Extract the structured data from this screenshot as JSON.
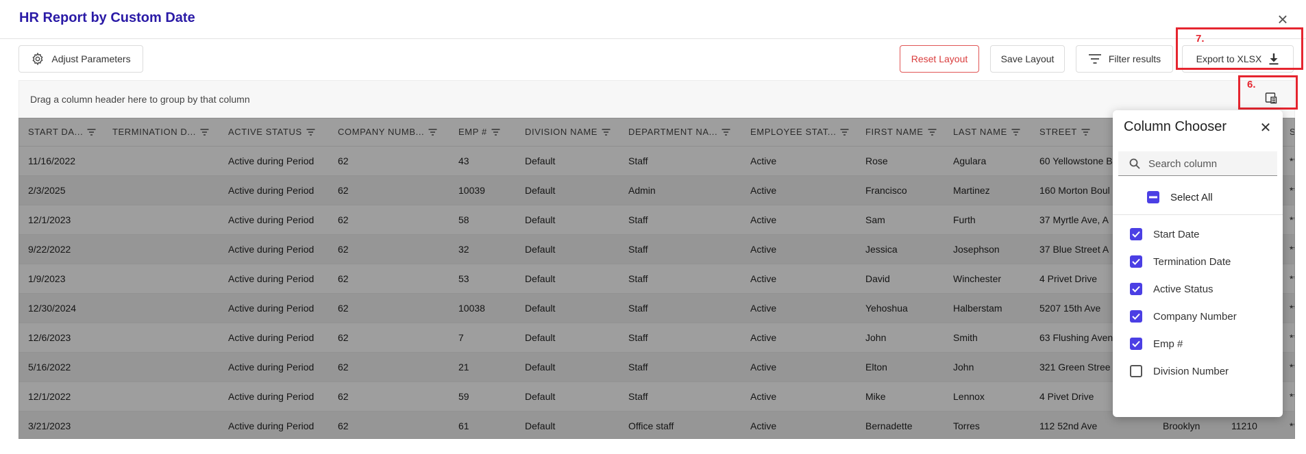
{
  "dialog": {
    "title": "HR Report by Custom Date"
  },
  "toolbar": {
    "adjust_label": "Adjust Parameters",
    "reset_label": "Reset Layout",
    "save_label": "Save Layout",
    "filter_label": "Filter results",
    "export_label": "Export to XLSX"
  },
  "annotations": {
    "seven": "7.",
    "six": "6."
  },
  "grid": {
    "group_hint": "Drag a column header here to group by that column",
    "columns": [
      "START DA...",
      "TERMINATION D...",
      "ACTIVE STATUS",
      "COMPANY NUMB...",
      "EMP #",
      "DIVISION NAME",
      "DEPARTMENT NA...",
      "EMPLOYEE STAT...",
      "FIRST NAME",
      "LAST NAME",
      "STREET",
      "",
      "",
      "S"
    ],
    "rows": [
      [
        "11/16/2022",
        "",
        "Active during Period",
        "62",
        "43",
        "Default",
        "Staff",
        "Active",
        "Rose",
        "Agulara",
        "60 Yellowstone B",
        "",
        "",
        "**"
      ],
      [
        "2/3/2025",
        "",
        "Active during Period",
        "62",
        "10039",
        "Default",
        "Admin",
        "Active",
        "Francisco",
        "Martinez",
        "160 Morton Boul",
        "",
        "",
        "**"
      ],
      [
        "12/1/2023",
        "",
        "Active during Period",
        "62",
        "58",
        "Default",
        "Staff",
        "Active",
        "Sam",
        "Furth",
        "37 Myrtle Ave, A",
        "",
        "",
        "**"
      ],
      [
        "9/22/2022",
        "",
        "Active during Period",
        "62",
        "32",
        "Default",
        "Staff",
        "Active",
        "Jessica",
        "Josephson",
        "37 Blue Street A",
        "",
        "",
        "**"
      ],
      [
        "1/9/2023",
        "",
        "Active during Period",
        "62",
        "53",
        "Default",
        "Staff",
        "Active",
        "David",
        "Winchester",
        "4 Privet Drive",
        "",
        "",
        "**"
      ],
      [
        "12/30/2024",
        "",
        "Active during Period",
        "62",
        "10038",
        "Default",
        "Staff",
        "Active",
        "Yehoshua",
        "Halberstam",
        "5207 15th Ave",
        "",
        "",
        "**"
      ],
      [
        "12/6/2023",
        "",
        "Active during Period",
        "62",
        "7",
        "Default",
        "Staff",
        "Active",
        "John",
        "Smith",
        "63 Flushing Aven",
        "",
        "",
        "**"
      ],
      [
        "5/16/2022",
        "",
        "Active during Period",
        "62",
        "21",
        "Default",
        "Staff",
        "Active",
        "Elton",
        "John",
        "321 Green Stree",
        "",
        "",
        "**"
      ],
      [
        "12/1/2022",
        "",
        "Active during Period",
        "62",
        "59",
        "Default",
        "Staff",
        "Active",
        "Mike",
        "Lennox",
        "4 Pivet Drive",
        "",
        "",
        "**"
      ],
      [
        "3/21/2023",
        "",
        "Active during Period",
        "62",
        "61",
        "Default",
        "Office staff",
        "Active",
        "Bernadette",
        "Torres",
        "112 52nd Ave",
        "Brooklyn",
        "11210",
        "**"
      ]
    ]
  },
  "column_chooser": {
    "title": "Column Chooser",
    "search_placeholder": "Search column",
    "select_all_label": "Select All",
    "options": [
      {
        "label": "Start Date",
        "checked": true
      },
      {
        "label": "Termination Date",
        "checked": true
      },
      {
        "label": "Active Status",
        "checked": true
      },
      {
        "label": "Company Number",
        "checked": true
      },
      {
        "label": "Emp #",
        "checked": true
      },
      {
        "label": "Division Number",
        "checked": false
      }
    ]
  },
  "colors": {
    "accent": "#4b3fe4",
    "title": "#2a1aa6",
    "danger": "#d93c3c",
    "highlight": "#e5252f"
  }
}
